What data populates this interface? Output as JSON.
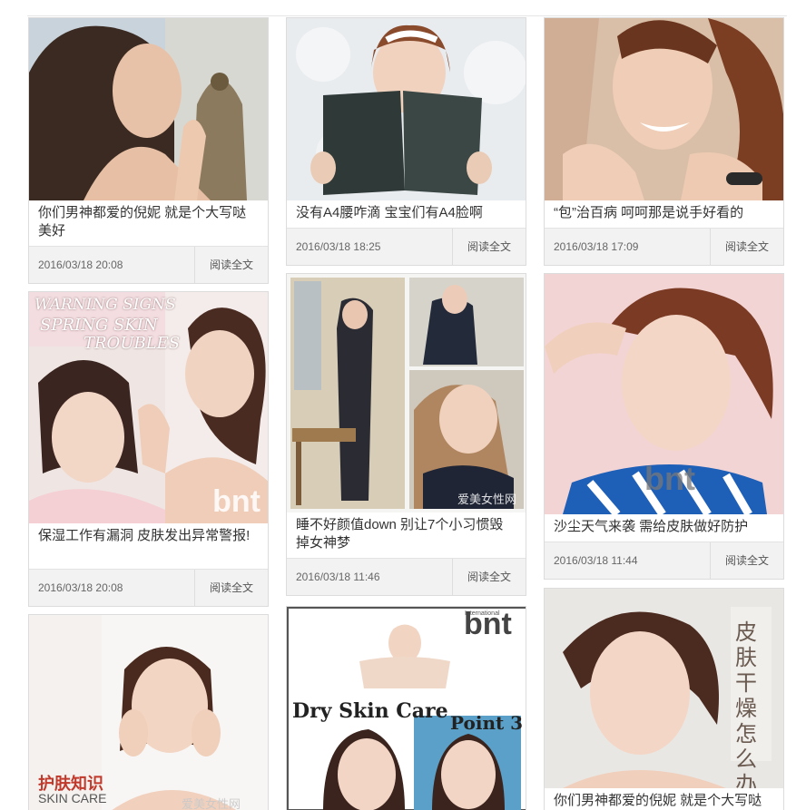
{
  "read_more_label": "阅读全文",
  "cards": [
    {
      "title": "你们男神都爱的倪妮 就是个大写哒美好",
      "date": "2016/03/18 20:08"
    },
    {
      "title": "没有A4腰咋滴 宝宝们有A4脸啊",
      "date": "2016/03/18 18:25"
    },
    {
      "title": "“包”治百病 呵呵那是说手好看的",
      "date": "2016/03/18 17:09"
    },
    {
      "title": "保湿工作有漏洞 皮肤发出异常警报!",
      "date": "2016/03/18 20:08",
      "image_text": {
        "line1": "WARNING SIGNS",
        "line2": "SPRING SKIN",
        "line3": "TROUBLES",
        "brand": "bnt"
      }
    },
    {
      "title": "睡不好颜值down 别让7个小习惯毁掉女神梦",
      "date": "2016/03/18 11:46",
      "image_text": {
        "watermark": "爱美女性网"
      }
    },
    {
      "title": "沙尘天气来袭 需给皮肤做好防护",
      "date": "2016/03/18 11:44",
      "image_text": {
        "brand": "bnt"
      }
    },
    {
      "title": "",
      "date": "",
      "image_text": {
        "tag_cn": "护肤知识",
        "tag_en": "SKIN CARE",
        "watermark": "爱美女性网"
      }
    },
    {
      "title": "",
      "date": "",
      "image_text": {
        "brand": "bnt",
        "brand_small": "International",
        "headline": "Dry Skin Care",
        "point": "Point 3"
      }
    },
    {
      "title": "你们男神都爱的倪妮 就是个大写哒",
      "date": "",
      "image_text": {
        "side_cn": "皮肤干燥怎么办"
      }
    }
  ]
}
